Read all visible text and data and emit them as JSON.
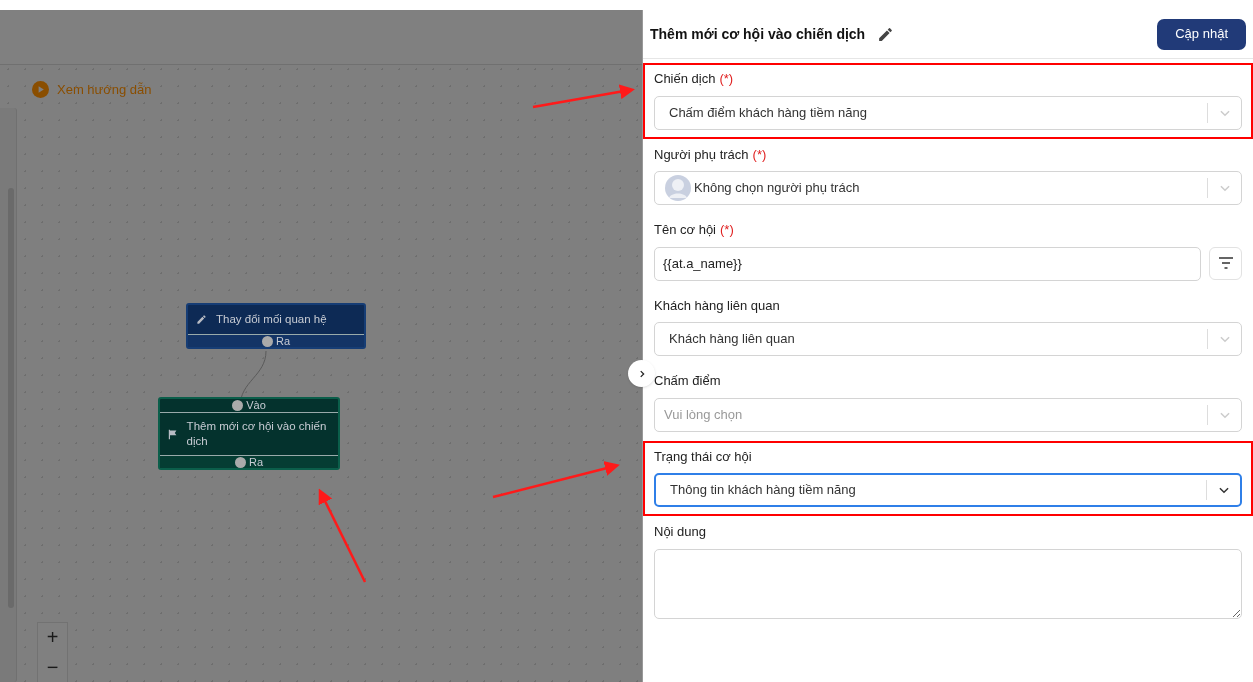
{
  "canvas": {
    "guide_link": "Xem hướng dẫn",
    "nodes": [
      {
        "kind": "action",
        "title": "Thay đổi mối quan hệ",
        "out_port": "Ra"
      },
      {
        "kind": "campaign",
        "title": "Thêm mới cơ hội vào chiến dịch",
        "in_port": "Vào",
        "out_port": "Ra"
      }
    ],
    "zoom_controls": [
      "+",
      "−"
    ]
  },
  "panel": {
    "title": "Thêm mới cơ hội vào chiến dịch",
    "save_button": "Cập nhật",
    "fields": [
      {
        "kind": "select",
        "label": "Chiến dịch",
        "required": "(*)",
        "value": "Chấm điểm khách hàng tiềm năng",
        "focused": false,
        "highlighted": true
      },
      {
        "kind": "person",
        "label": "Người phụ trách",
        "required": "(*)",
        "value": "Không chọn người phụ trách",
        "focused": false,
        "highlighted": false
      },
      {
        "kind": "text",
        "label": "Tên cơ hội",
        "required": "(*)",
        "value": "{{at.a_name}}",
        "focused": false,
        "highlighted": false
      },
      {
        "kind": "select",
        "label": "Khách hàng liên quan",
        "value": "Khách hàng liên quan",
        "focused": false,
        "highlighted": false
      },
      {
        "kind": "select",
        "label": "Chấm điểm",
        "placeholder": "Vui lòng chọn",
        "focused": false,
        "highlighted": false
      },
      {
        "kind": "select",
        "label": "Trạng thái cơ hội",
        "value": "Thông tin khách hàng tiềm năng",
        "focused": true,
        "highlighted": true
      },
      {
        "kind": "textarea",
        "label": "Nội dung",
        "focused": false,
        "highlighted": false
      }
    ]
  }
}
